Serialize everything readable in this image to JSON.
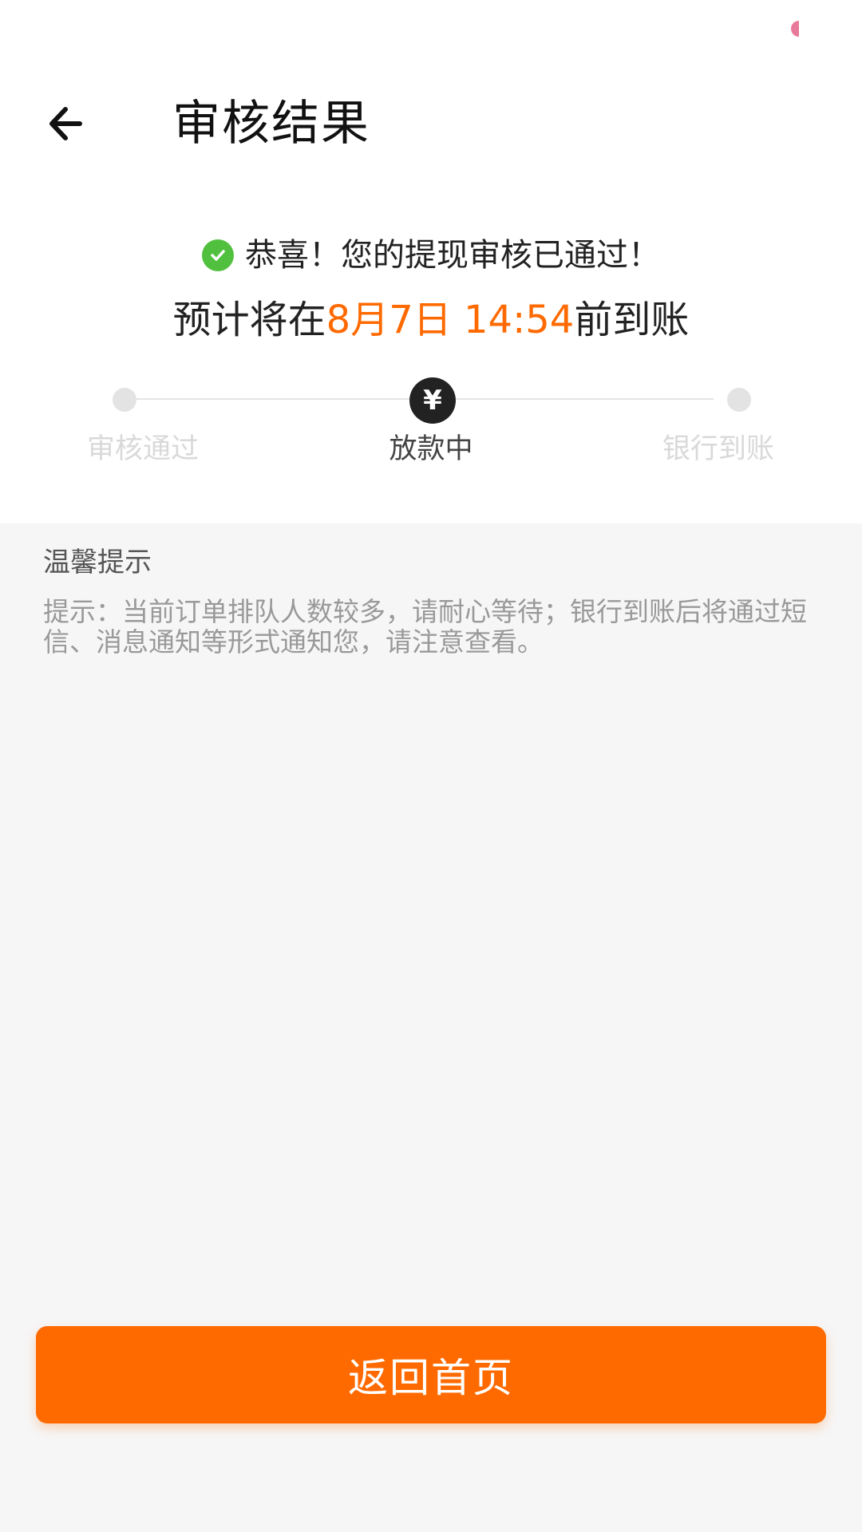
{
  "header": {
    "title": "审核结果",
    "back_icon": "arrow-left-icon"
  },
  "result": {
    "success_icon": "check-circle-icon",
    "success_text": "恭喜！您的提现审核已通过！",
    "eta_prefix": "预计将在",
    "eta_time": "8月7日 14:54",
    "eta_suffix": "前到账"
  },
  "steps": [
    {
      "label": "审核通过",
      "state": "done"
    },
    {
      "label": "放款中",
      "state": "current",
      "icon": "¥"
    },
    {
      "label": "银行到账",
      "state": "pending"
    }
  ],
  "tips": {
    "title": "温馨提示",
    "text": "提示：当前订单排队人数较多，请耐心等待；银行到账后将通过短信、消息通知等形式通知您，请注意查看。"
  },
  "footer": {
    "home_button_label": "返回首页"
  },
  "colors": {
    "accent": "#ff6a00",
    "success": "#52c03f",
    "background": "#f6f6f6"
  }
}
